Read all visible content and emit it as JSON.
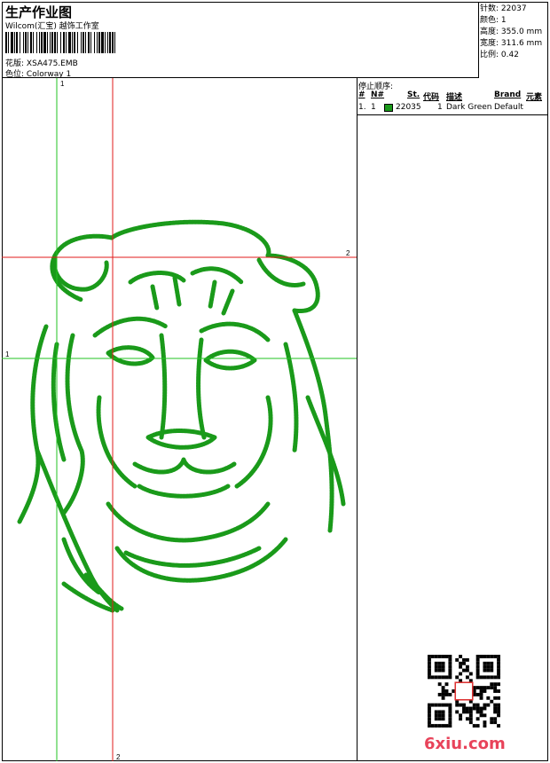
{
  "header": {
    "title": "生产作业图",
    "company": "Wilcom(汇宝) 越饰工作室",
    "design_label": "花版:",
    "design_value": "XSA475.EMB",
    "colorway_label": "色位:",
    "colorway_value": "Colorway 1"
  },
  "stats": {
    "stitches_label": "针数:",
    "stitches_value": "22037",
    "colors_label": "颜色:",
    "colors_value": "1",
    "height_label": "高度:",
    "height_value": "355.0 mm",
    "width_label": "宽度:",
    "width_value": "311.6 mm",
    "scale_label": "比例:",
    "scale_value": "0.42"
  },
  "stop_sequence": {
    "title": "停止顺序:",
    "columns": [
      "#",
      "N#",
      "St.",
      "代码",
      "描述",
      "Brand",
      "元素"
    ],
    "rows": [
      {
        "index": "1.",
        "needle": "1",
        "color": "#1a9a1a",
        "stitches": "22035",
        "code": "1",
        "description": "Dark Green",
        "brand": "Default"
      }
    ]
  },
  "guides": {
    "vertical_1": "1",
    "vertical_2": "2",
    "horizontal_1": "1",
    "horizontal_2": "2"
  },
  "colors": {
    "thread": "#1a9a1a",
    "guide_green": "#22c322",
    "guide_red": "#e01b1b",
    "watermark": "#e8435a"
  },
  "watermark": {
    "text": "6xiu.com",
    "qr_icon": "qr-code-icon"
  }
}
